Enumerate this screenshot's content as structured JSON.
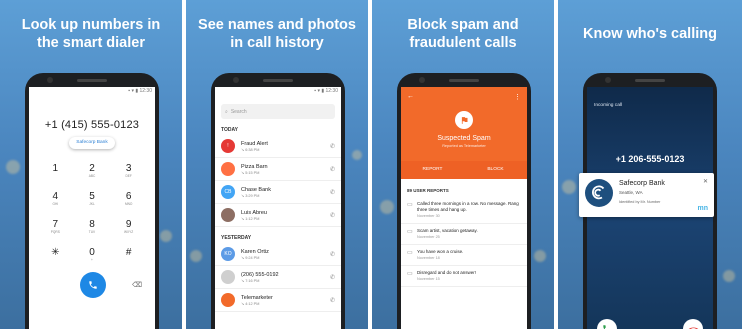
{
  "panels": {
    "dialer": {
      "headline": [
        "Look up numbers in",
        "the smart dialer"
      ],
      "time": "12:30",
      "number": "+1 (415) 555-0123",
      "chip": "Safecorp Bank",
      "keys": [
        {
          "d": "1",
          "l": ""
        },
        {
          "d": "2",
          "l": "ABC"
        },
        {
          "d": "3",
          "l": "DEF"
        },
        {
          "d": "4",
          "l": "GHI"
        },
        {
          "d": "5",
          "l": "JKL"
        },
        {
          "d": "6",
          "l": "MNO"
        },
        {
          "d": "7",
          "l": "PQRS"
        },
        {
          "d": "8",
          "l": "TUV"
        },
        {
          "d": "9",
          "l": "WXYZ"
        },
        {
          "d": "✳",
          "l": ""
        },
        {
          "d": "0",
          "l": "+"
        },
        {
          "d": "#",
          "l": ""
        }
      ]
    },
    "history": {
      "headline": [
        "See names and photos",
        "in call history"
      ],
      "time": "12:30",
      "search_placeholder": "Search",
      "today": "TODAY",
      "yesterday": "YESTERDAY",
      "today_rows": [
        {
          "name": "Fraud Alert",
          "time": "6:38 PM",
          "avatar": "!",
          "color": "#e53935"
        },
        {
          "name": "Pizza Barn",
          "time": "5:15 PM",
          "avatar": "",
          "color": "#ff7043"
        },
        {
          "name": "Chase Bank",
          "time": "3:29 PM",
          "avatar": "CB",
          "color": "#42a5f5"
        },
        {
          "name": "Luis Abreu",
          "time": "1:12 PM",
          "avatar": "",
          "color": "#8d6e63"
        }
      ],
      "yesterday_rows": [
        {
          "name": "Karen Ortiz",
          "time": "9:24 PM",
          "avatar": "KO",
          "color": "#5c9be6"
        },
        {
          "name": "(206) 555-0192",
          "time": "7:16 PM",
          "avatar": "",
          "color": "#cfcfcf"
        },
        {
          "name": "Telemarketer",
          "time": "4:12 PM",
          "avatar": "",
          "color": "#f26a2a"
        }
      ]
    },
    "spam": {
      "headline": [
        "Block spam and",
        "fraudulent calls"
      ],
      "title": "Suspected Spam",
      "sub": "Reported as Telemarketer",
      "report": "REPORT",
      "block": "BLOCK",
      "reports_head": "89 USER REPORTS",
      "reports": [
        {
          "text": "Called three mornings in a row. No message. Rang three times and hang up.",
          "date": "November 30"
        },
        {
          "text": "Scam artist, vacation getaway.",
          "date": "November 25"
        },
        {
          "text": "You have won a cruise.",
          "date": "November 18"
        },
        {
          "text": "Disregard and do not answer!",
          "date": "November 15"
        }
      ]
    },
    "caller": {
      "headline": [
        "Know who's calling"
      ],
      "incoming": "Incoming call",
      "number": "+1 206-555-0123",
      "name": "Safecorp Bank",
      "city": "Seattle, WA",
      "by": "Identified by Mr. Number",
      "mark": "mn"
    }
  },
  "colors": {
    "accent": "#1e88e5",
    "spam": "#f26a2a"
  }
}
